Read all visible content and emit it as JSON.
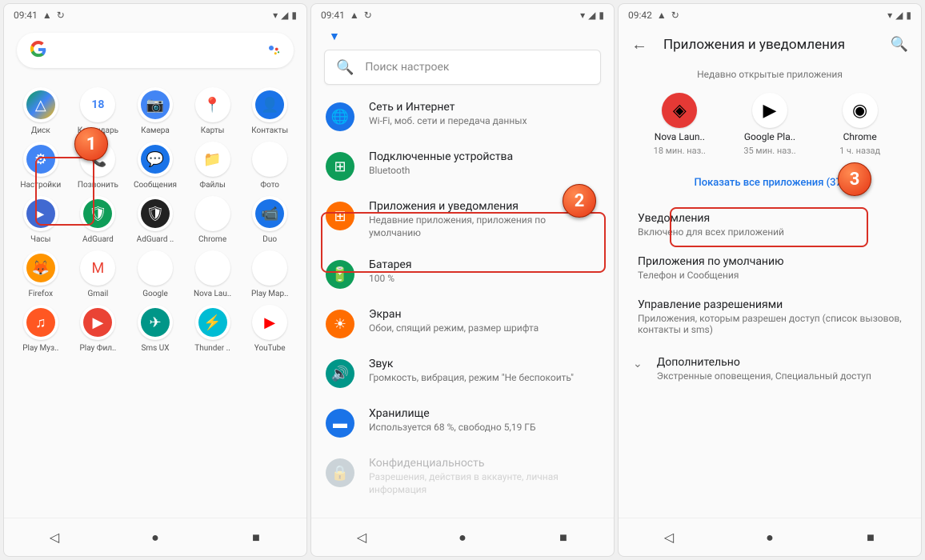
{
  "screens": [
    {
      "time": "09:41",
      "search_placeholder": "",
      "apps": [
        {
          "label": "Диск",
          "icon": "△"
        },
        {
          "label": "Календарь",
          "icon": "18"
        },
        {
          "label": "Камера",
          "icon": "📷"
        },
        {
          "label": "Карты",
          "icon": "📍"
        },
        {
          "label": "Контакты",
          "icon": "👤"
        },
        {
          "label": "Настройки",
          "icon": "⚙"
        },
        {
          "label": "Позвонить",
          "icon": "📞"
        },
        {
          "label": "Сообщения",
          "icon": "💬"
        },
        {
          "label": "Файлы",
          "icon": "📁"
        },
        {
          "label": "Фото",
          "icon": "✦"
        },
        {
          "label": "Часы",
          "icon": "▸"
        },
        {
          "label": "AdGuard",
          "icon": "🛡"
        },
        {
          "label": "AdGuard ..",
          "icon": "🛡"
        },
        {
          "label": "Chrome",
          "icon": "◉"
        },
        {
          "label": "Duo",
          "icon": "📹"
        },
        {
          "label": "Firefox",
          "icon": "🦊"
        },
        {
          "label": "Gmail",
          "icon": "M"
        },
        {
          "label": "Google",
          "icon": "G"
        },
        {
          "label": "Nova Lau..",
          "icon": "◈"
        },
        {
          "label": "Play Мар..",
          "icon": "▶"
        },
        {
          "label": "Play Муз..",
          "icon": "♫"
        },
        {
          "label": "Play Фил..",
          "icon": "▶"
        },
        {
          "label": "Sms UX",
          "icon": "✈"
        },
        {
          "label": "Thunder ..",
          "icon": "⚡"
        },
        {
          "label": "YouTube",
          "icon": "▶"
        }
      ],
      "callout": "1"
    },
    {
      "time": "09:41",
      "search_placeholder": "Поиск настроек",
      "settings": [
        {
          "title": "Сеть и Интернет",
          "sub": "Wi-Fi, моб. сети и передача данных"
        },
        {
          "title": "Подключенные устройства",
          "sub": "Bluetooth"
        },
        {
          "title": "Приложения и уведомления",
          "sub": "Недавние приложения, приложения по умолчанию"
        },
        {
          "title": "Батарея",
          "sub": "100 %"
        },
        {
          "title": "Экран",
          "sub": "Обои, спящий режим, размер шрифта"
        },
        {
          "title": "Звук",
          "sub": "Громкость, вибрация, режим \"Не беспокоить\""
        },
        {
          "title": "Хранилище",
          "sub": "Используется 68 %, свободно 5,19 ГБ"
        },
        {
          "title": "Конфиденциальность",
          "sub": "Разрешения, действия в аккаунте, личная информация"
        }
      ],
      "callout": "2"
    },
    {
      "time": "09:42",
      "header": "Приложения и уведомления",
      "section_label": "Недавно открытые приложения",
      "recent": [
        {
          "name": "Nova Laun..",
          "time": "18 мин. наз..",
          "icon": "◈"
        },
        {
          "name": "Google Pla..",
          "time": "35 мин. наз..",
          "icon": "▶"
        },
        {
          "name": "Chrome",
          "time": "1 ч. назад",
          "icon": "◉"
        }
      ],
      "show_all": "Показать все приложения (37)",
      "details": [
        {
          "title": "Уведомления",
          "sub": "Включено для всех приложений"
        },
        {
          "title": "Приложения по умолчанию",
          "sub": "Телефон и Сообщения"
        },
        {
          "title": "Управление разрешениями",
          "sub": "Приложения, которым разрешен доступ (список вызовов, контакты и sms)"
        }
      ],
      "advanced": {
        "title": "Дополнительно",
        "sub": "Экстренные оповещения, Специальный доступ"
      },
      "callout": "3"
    }
  ]
}
